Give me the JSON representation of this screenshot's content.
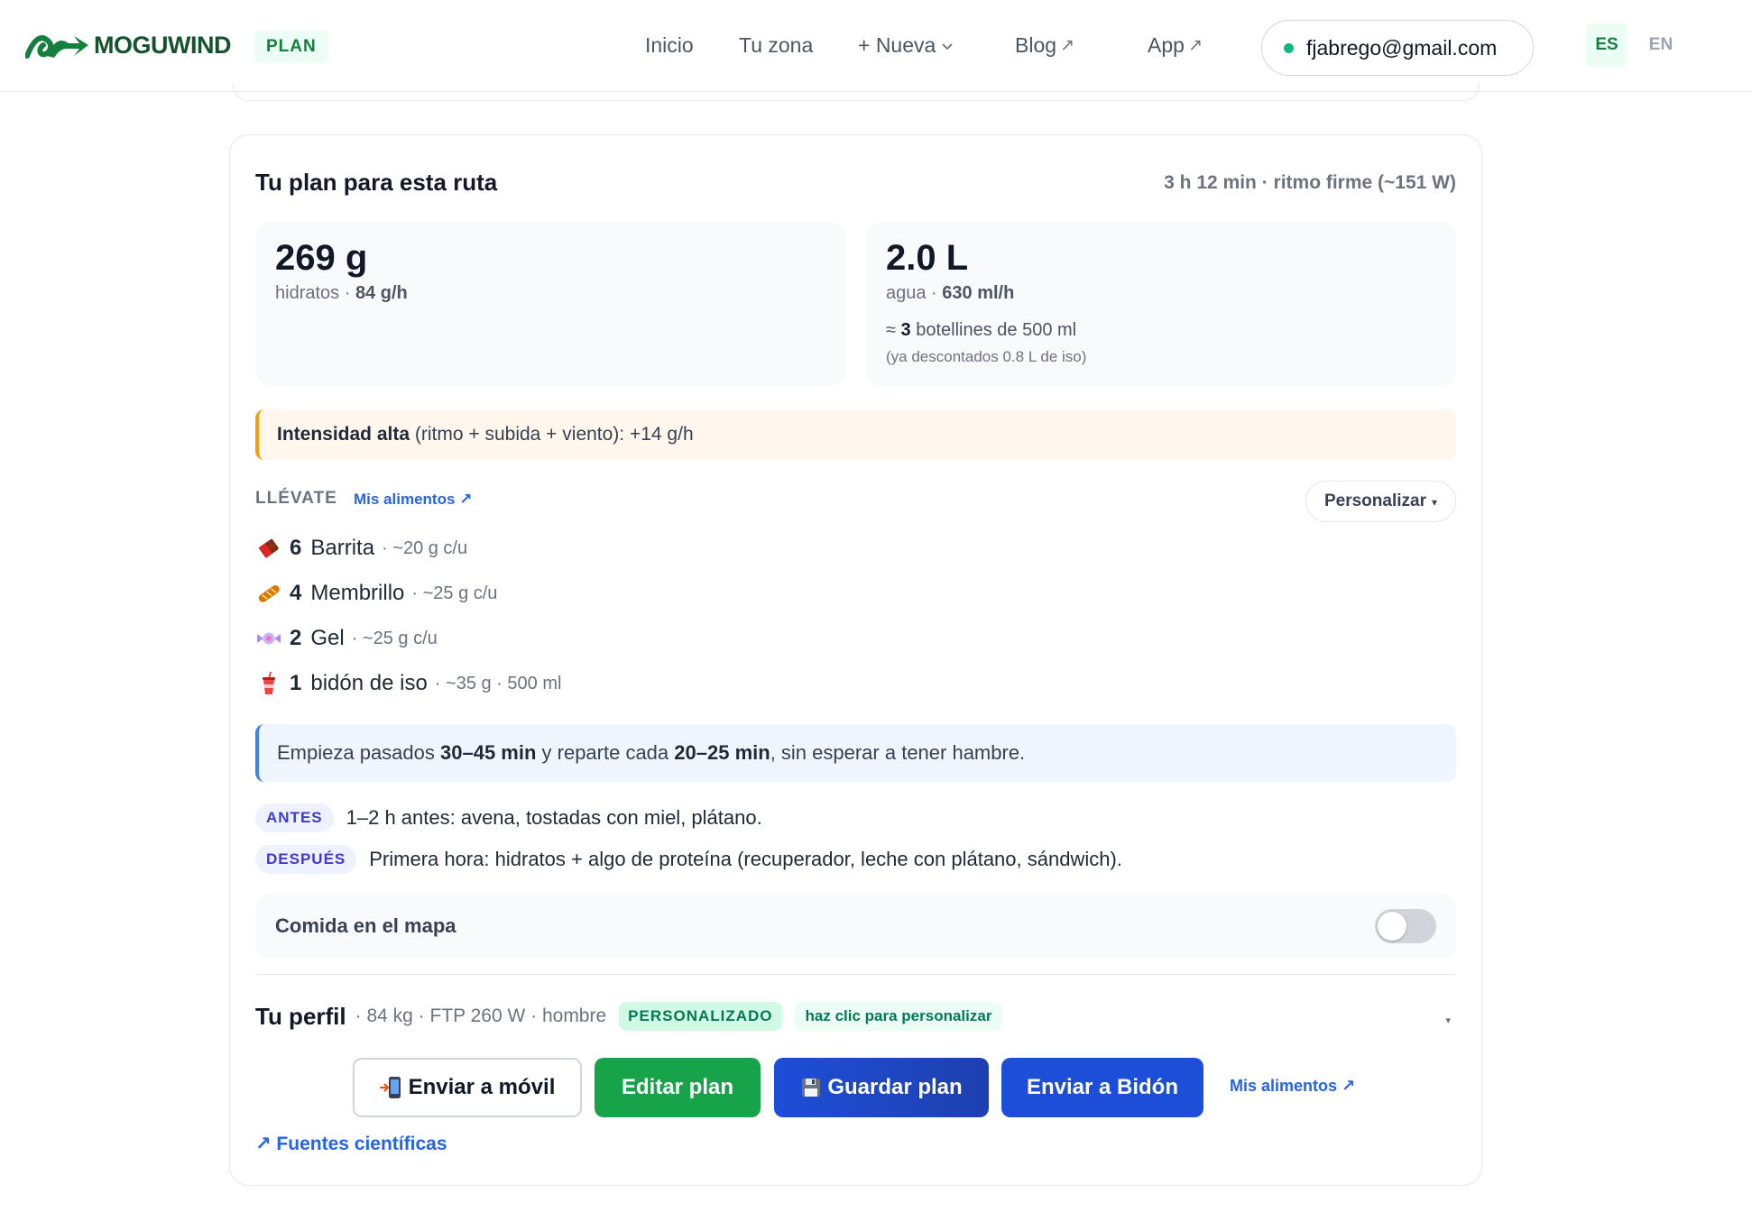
{
  "header": {
    "brand": "MOGUWIND",
    "plan_badge": "PLAN",
    "nav": {
      "inicio": "Inicio",
      "tu_zona": "Tu zona",
      "nueva": "+ Nueva",
      "blog": "Blog",
      "app": "App"
    },
    "ext_glyph": "↗",
    "email": "fjabrego@gmail.com",
    "lang_es": "ES",
    "lang_en": "EN"
  },
  "plan": {
    "title": "Tu plan para esta ruta",
    "meta": "3 h 12 min · ritmo firme (~151 W)",
    "carbs": {
      "value": "269 g",
      "label": "hidratos · ",
      "rate": "84 g/h"
    },
    "water": {
      "value": "2.0 L",
      "label": "agua · ",
      "rate": "630 ml/h",
      "bottles_prefix": "≈ ",
      "bottles_count": "3",
      "bottles_suffix": " botellines de 500 ml",
      "note": "(ya descontados 0.8 L de iso)"
    },
    "warning": {
      "bold": "Intensidad alta",
      "rest": " (ritmo + subida + viento): +14 g/h"
    },
    "llevate": {
      "label": "LLÉVATE",
      "link": "Mis alimentos ↗",
      "customize": "Personalizar",
      "customize_caret": "▾"
    },
    "foods": [
      {
        "icon": "chocolate-bar-icon",
        "qty": "6",
        "name": "Barrita",
        "detail": "· ~20 g c/u"
      },
      {
        "icon": "baguette-icon",
        "qty": "4",
        "name": "Membrillo",
        "detail": "· ~25 g c/u"
      },
      {
        "icon": "candy-icon",
        "qty": "2",
        "name": "Gel",
        "detail": "· ~25 g c/u"
      },
      {
        "icon": "cup-with-straw-icon",
        "qty": "1",
        "name": "bidón de iso",
        "detail": "· ~35 g · 500 ml"
      }
    ],
    "timing": {
      "p1": "Empieza pasados ",
      "b1": "30–45 min",
      "p2": " y reparte cada ",
      "b2": "20–25 min",
      "p3": ", sin esperar a tener hambre."
    },
    "before": {
      "tag": "ANTES",
      "text": "1–2 h antes: avena, tostadas con miel, plátano."
    },
    "after": {
      "tag": "DESPUÉS",
      "text": "Primera hora: hidratos + algo de proteína (recuperador, leche con plátano, sándwich)."
    },
    "map_toggle": {
      "label": "Comida en el mapa",
      "on": false
    }
  },
  "profile": {
    "title": "Tu perfil",
    "meta": "· 84 kg · FTP 260 W · hombre",
    "badge": "PERSONALIZADO",
    "hint": "haz clic para personalizar",
    "caret": "▾"
  },
  "actions": {
    "send_mobile": "Enviar a móvil",
    "edit_plan": "Editar plan",
    "save_plan": "Guardar plan",
    "send_bidon": "Enviar a Bidón",
    "my_foods": "Mis alimentos ↗"
  },
  "sources_link": "↗ Fuentes científicas",
  "colors": {
    "brand_green": "#14532d",
    "accent_green": "#16a34a",
    "primary_blue": "#1d4ed8",
    "link_blue": "#2563eb",
    "warning_amber": "#f59e0b"
  }
}
